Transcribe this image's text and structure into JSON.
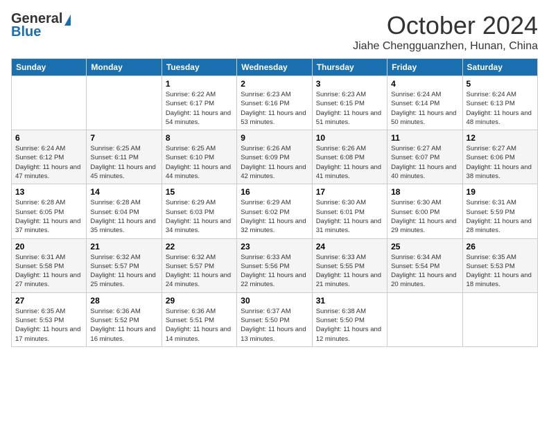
{
  "header": {
    "logo_general": "General",
    "logo_blue": "Blue",
    "month": "October 2024",
    "location": "Jiahe Chengguanzhen, Hunan, China"
  },
  "weekdays": [
    "Sunday",
    "Monday",
    "Tuesday",
    "Wednesday",
    "Thursday",
    "Friday",
    "Saturday"
  ],
  "weeks": [
    [
      {
        "day": "",
        "info": ""
      },
      {
        "day": "",
        "info": ""
      },
      {
        "day": "1",
        "info": "Sunrise: 6:22 AM\nSunset: 6:17 PM\nDaylight: 11 hours and 54 minutes."
      },
      {
        "day": "2",
        "info": "Sunrise: 6:23 AM\nSunset: 6:16 PM\nDaylight: 11 hours and 53 minutes."
      },
      {
        "day": "3",
        "info": "Sunrise: 6:23 AM\nSunset: 6:15 PM\nDaylight: 11 hours and 51 minutes."
      },
      {
        "day": "4",
        "info": "Sunrise: 6:24 AM\nSunset: 6:14 PM\nDaylight: 11 hours and 50 minutes."
      },
      {
        "day": "5",
        "info": "Sunrise: 6:24 AM\nSunset: 6:13 PM\nDaylight: 11 hours and 48 minutes."
      }
    ],
    [
      {
        "day": "6",
        "info": "Sunrise: 6:24 AM\nSunset: 6:12 PM\nDaylight: 11 hours and 47 minutes."
      },
      {
        "day": "7",
        "info": "Sunrise: 6:25 AM\nSunset: 6:11 PM\nDaylight: 11 hours and 45 minutes."
      },
      {
        "day": "8",
        "info": "Sunrise: 6:25 AM\nSunset: 6:10 PM\nDaylight: 11 hours and 44 minutes."
      },
      {
        "day": "9",
        "info": "Sunrise: 6:26 AM\nSunset: 6:09 PM\nDaylight: 11 hours and 42 minutes."
      },
      {
        "day": "10",
        "info": "Sunrise: 6:26 AM\nSunset: 6:08 PM\nDaylight: 11 hours and 41 minutes."
      },
      {
        "day": "11",
        "info": "Sunrise: 6:27 AM\nSunset: 6:07 PM\nDaylight: 11 hours and 40 minutes."
      },
      {
        "day": "12",
        "info": "Sunrise: 6:27 AM\nSunset: 6:06 PM\nDaylight: 11 hours and 38 minutes."
      }
    ],
    [
      {
        "day": "13",
        "info": "Sunrise: 6:28 AM\nSunset: 6:05 PM\nDaylight: 11 hours and 37 minutes."
      },
      {
        "day": "14",
        "info": "Sunrise: 6:28 AM\nSunset: 6:04 PM\nDaylight: 11 hours and 35 minutes."
      },
      {
        "day": "15",
        "info": "Sunrise: 6:29 AM\nSunset: 6:03 PM\nDaylight: 11 hours and 34 minutes."
      },
      {
        "day": "16",
        "info": "Sunrise: 6:29 AM\nSunset: 6:02 PM\nDaylight: 11 hours and 32 minutes."
      },
      {
        "day": "17",
        "info": "Sunrise: 6:30 AM\nSunset: 6:01 PM\nDaylight: 11 hours and 31 minutes."
      },
      {
        "day": "18",
        "info": "Sunrise: 6:30 AM\nSunset: 6:00 PM\nDaylight: 11 hours and 29 minutes."
      },
      {
        "day": "19",
        "info": "Sunrise: 6:31 AM\nSunset: 5:59 PM\nDaylight: 11 hours and 28 minutes."
      }
    ],
    [
      {
        "day": "20",
        "info": "Sunrise: 6:31 AM\nSunset: 5:58 PM\nDaylight: 11 hours and 27 minutes."
      },
      {
        "day": "21",
        "info": "Sunrise: 6:32 AM\nSunset: 5:57 PM\nDaylight: 11 hours and 25 minutes."
      },
      {
        "day": "22",
        "info": "Sunrise: 6:32 AM\nSunset: 5:57 PM\nDaylight: 11 hours and 24 minutes."
      },
      {
        "day": "23",
        "info": "Sunrise: 6:33 AM\nSunset: 5:56 PM\nDaylight: 11 hours and 22 minutes."
      },
      {
        "day": "24",
        "info": "Sunrise: 6:33 AM\nSunset: 5:55 PM\nDaylight: 11 hours and 21 minutes."
      },
      {
        "day": "25",
        "info": "Sunrise: 6:34 AM\nSunset: 5:54 PM\nDaylight: 11 hours and 20 minutes."
      },
      {
        "day": "26",
        "info": "Sunrise: 6:35 AM\nSunset: 5:53 PM\nDaylight: 11 hours and 18 minutes."
      }
    ],
    [
      {
        "day": "27",
        "info": "Sunrise: 6:35 AM\nSunset: 5:53 PM\nDaylight: 11 hours and 17 minutes."
      },
      {
        "day": "28",
        "info": "Sunrise: 6:36 AM\nSunset: 5:52 PM\nDaylight: 11 hours and 16 minutes."
      },
      {
        "day": "29",
        "info": "Sunrise: 6:36 AM\nSunset: 5:51 PM\nDaylight: 11 hours and 14 minutes."
      },
      {
        "day": "30",
        "info": "Sunrise: 6:37 AM\nSunset: 5:50 PM\nDaylight: 11 hours and 13 minutes."
      },
      {
        "day": "31",
        "info": "Sunrise: 6:38 AM\nSunset: 5:50 PM\nDaylight: 11 hours and 12 minutes."
      },
      {
        "day": "",
        "info": ""
      },
      {
        "day": "",
        "info": ""
      }
    ]
  ]
}
